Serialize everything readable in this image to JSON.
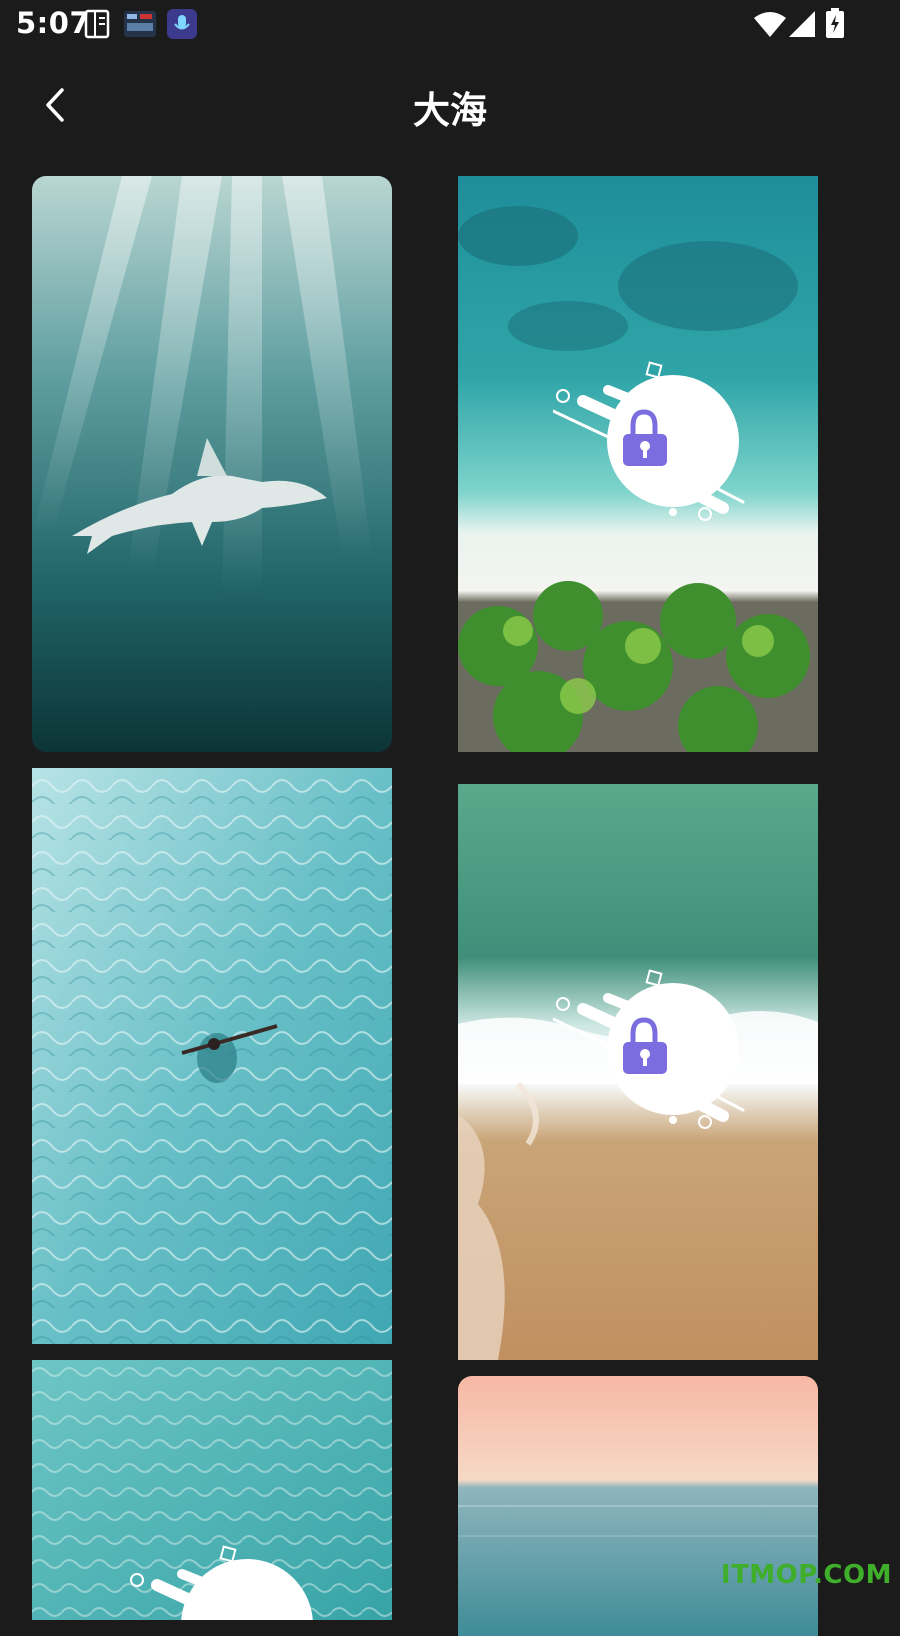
{
  "status_bar": {
    "time": "5:07",
    "notification_icons": [
      "book-icon",
      "clock-widget-icon",
      "voice-recorder-icon"
    ],
    "system_icons": [
      "wifi-icon",
      "signal-icon",
      "battery-charging-icon"
    ]
  },
  "header": {
    "back_icon": "chevron-left-icon",
    "title": "大海"
  },
  "wallpapers": [
    {
      "subject": "shark underwater",
      "locked": false
    },
    {
      "subject": "aerial beach with palm trees",
      "locked": true
    },
    {
      "subject": "swimmer in clear water",
      "locked": false
    },
    {
      "subject": "waves on sandy shore",
      "locked": true
    },
    {
      "subject": "shallow turquoise water",
      "locked": true
    },
    {
      "subject": "ocean horizon at sunset",
      "locked": false
    }
  ],
  "colors": {
    "background": "#1b1b1b",
    "lock_accent": "#7b6ce0",
    "watermark": "#3fae2a"
  },
  "watermark": "ITMOP.COM"
}
